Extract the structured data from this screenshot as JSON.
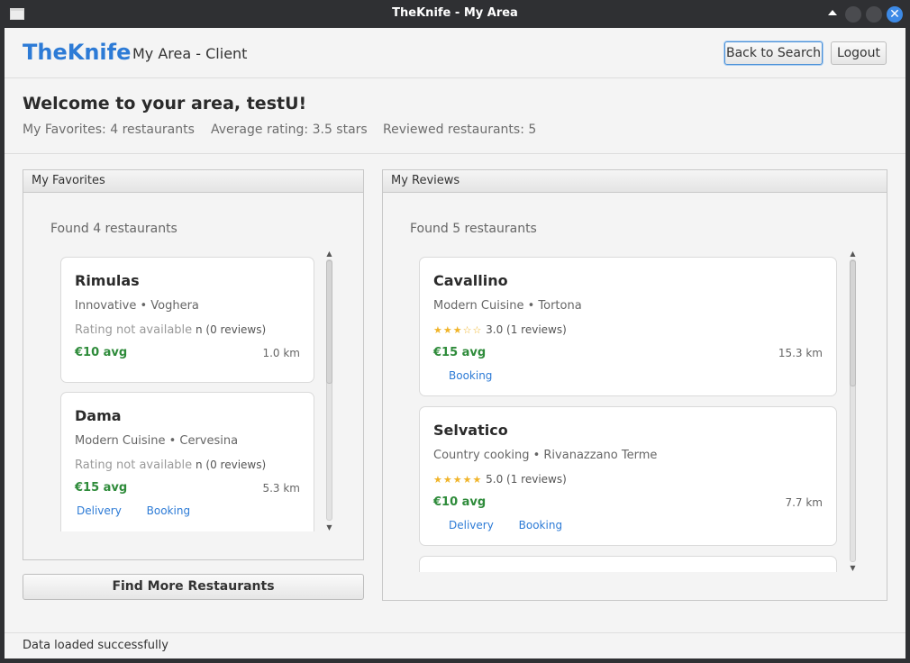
{
  "window": {
    "title": "TheKnife - My Area"
  },
  "header": {
    "brand": "TheKnife",
    "subtitle": "My Area - Client",
    "back_button": "Back to Search",
    "logout_button": "Logout"
  },
  "welcome": {
    "title": "Welcome to your area, testU!",
    "favorites_count": "My Favorites: 4 restaurants",
    "average_rating": "Average rating: 3.5 stars",
    "reviewed_count": "Reviewed restaurants: 5"
  },
  "favorites": {
    "panel_title": "My Favorites",
    "found": "Found 4 restaurants",
    "items": [
      {
        "name": "Rimulas",
        "type": "Innovative • Voghera",
        "rating_na": "Rating not available",
        "reviews": "n (0 reviews)",
        "price": "€10 avg",
        "distance": "1.0 km",
        "links": []
      },
      {
        "name": "Dama",
        "type": "Modern Cuisine • Cervesina",
        "rating_na": "Rating not available",
        "reviews": "n (0 reviews)",
        "price": "€15 avg",
        "distance": "5.3 km",
        "links": [
          "Delivery",
          "Booking"
        ]
      }
    ]
  },
  "reviews": {
    "panel_title": "My Reviews",
    "found": "Found 5 restaurants",
    "items": [
      {
        "name": "Cavallino",
        "type": "Modern Cuisine • Tortona",
        "stars": "★★★☆☆",
        "rating": "3.0 (1 reviews)",
        "price": "€15 avg",
        "distance": "15.3 km",
        "links": [
          "Booking"
        ]
      },
      {
        "name": "Selvatico",
        "type": "Country cooking • Rivanazzano Terme",
        "stars": "★★★★★",
        "rating": "5.0 (1 reviews)",
        "price": "€10 avg",
        "distance": "7.7 km",
        "links": [
          "Delivery",
          "Booking"
        ]
      }
    ]
  },
  "find_more_button": "Find More Restaurants",
  "status": "Data loaded successfully",
  "colors": {
    "brand": "#2d7bd6",
    "price": "#2e8b3a",
    "stars": "#f0b429",
    "link": "#2d7bd6"
  }
}
